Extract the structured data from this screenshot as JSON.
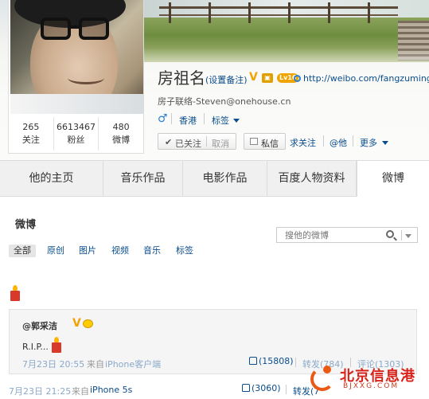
{
  "profile": {
    "name": "房祖名",
    "remark": "(设置备注)",
    "verified_badge": "V",
    "level_badge": "Lv16",
    "weibo_url": "http://weibo.com/fangzuming",
    "bio": "房子联络-Steven@onehouse.cn",
    "gender_symbol": "♂",
    "location": "香港",
    "tags_label": "标签",
    "stats": [
      {
        "value": "265",
        "label": "关注"
      },
      {
        "value": "6613467",
        "label": "粉丝"
      },
      {
        "value": "480",
        "label": "微博"
      }
    ]
  },
  "actions": {
    "follow_check": "✔",
    "followed_label": "已关注",
    "cancel_label": "取消",
    "message_label": "私信",
    "seek_follow_label": "求关注",
    "at_label": "@他",
    "more_label": "更多"
  },
  "tabs": [
    {
      "label": "他的主页"
    },
    {
      "label": "音乐作品"
    },
    {
      "label": "电影作品"
    },
    {
      "label": "百度人物资料"
    },
    {
      "label": "微博",
      "active": true
    }
  ],
  "main": {
    "section_title": "微博",
    "search_placeholder": "搜他的微博",
    "filters": [
      "全部",
      "原创",
      "图片",
      "视频",
      "音乐",
      "标签"
    ]
  },
  "post": {
    "retweet": {
      "author": "@郭采洁",
      "verified_badge": "V",
      "text": "R.I.P...",
      "time": "7月23日 20:55",
      "from_label": "来自",
      "source": "iPhone客户端",
      "likes": "(15808)",
      "repost_label": "转发(784)",
      "comment_label": "评论(1303)"
    },
    "time": "7月23日 21:25",
    "from_label": "来自",
    "source": "iPhone 5s",
    "likes": "(3060)",
    "repost_label": "转发(7"
  },
  "watermark": {
    "title": "北京信息港",
    "url": "BJXXG.COM"
  },
  "icons": {
    "candle": "candle-icon",
    "thumb": "thumb-up-icon",
    "search": "search-icon"
  },
  "colors": {
    "link": "#0a4d8c",
    "verified": "#f2a300",
    "watermark": "#d8221a"
  }
}
